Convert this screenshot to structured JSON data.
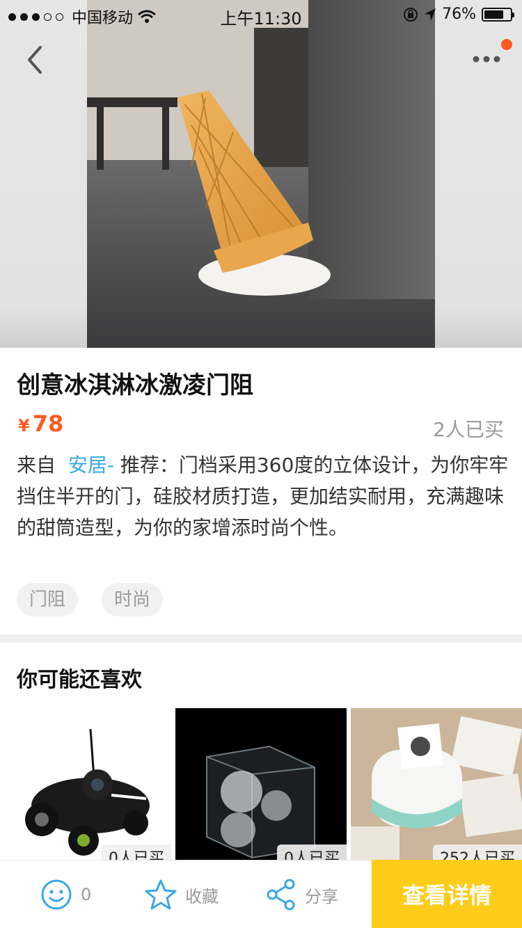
{
  "status": {
    "carrier": "中国移动",
    "time": "上午11:30",
    "battery": "76%"
  },
  "product": {
    "title": "创意冰淇淋冰激凌门阻",
    "currency": "¥",
    "price": "78",
    "sold": "2人已买",
    "desc_from": "来自",
    "desc_link": "安居-",
    "desc_body": " 推荐：门档采用360度的立体设计，为你牢牢挡住半开的门，硅胶材质打造，更加结实耐用，充满趣味的甜筒造型，为你的家增添时尚个性。",
    "tags": [
      "门阻",
      "时尚"
    ]
  },
  "recommend": {
    "title": "你可能还喜欢",
    "items": [
      {
        "badge": "0人已买"
      },
      {
        "badge": "0人已买"
      },
      {
        "badge": "252人已买"
      }
    ]
  },
  "bottom": {
    "like_count": "0",
    "favorite_label": "收藏",
    "share_label": "分享",
    "cta_label": "查看详情"
  },
  "colors": {
    "accent": "#ff5a1f",
    "link": "#3aa7e2",
    "cta": "#ffcc1a",
    "icon": "#3aa7e2"
  }
}
